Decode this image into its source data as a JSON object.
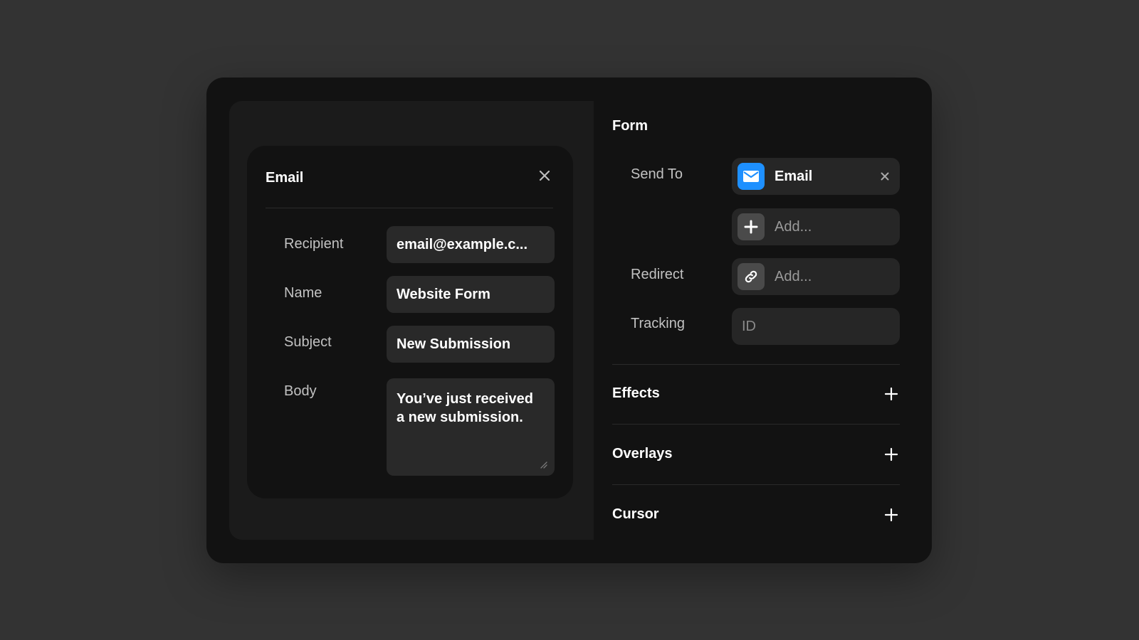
{
  "email_card": {
    "title": "Email",
    "fields": [
      {
        "label": "Recipient",
        "value": "email@example.c..."
      },
      {
        "label": "Name",
        "value": "Website Form"
      },
      {
        "label": "Subject",
        "value": "New Submission"
      },
      {
        "label": "Body",
        "value": "You’ve just received a new submission."
      }
    ]
  },
  "form_panel": {
    "title": "Form",
    "send_to": {
      "label": "Send To",
      "selected": "Email",
      "add_placeholder": "Add..."
    },
    "redirect": {
      "label": "Redirect",
      "placeholder": "Add..."
    },
    "tracking": {
      "label": "Tracking",
      "placeholder": "ID"
    },
    "sections": [
      {
        "label": "Effects"
      },
      {
        "label": "Overlays"
      },
      {
        "label": "Cursor"
      }
    ]
  },
  "icons": {
    "close": "close-icon",
    "mail": "mail-icon",
    "add": "plus-icon",
    "link": "link-icon",
    "resize": "resize-handle-icon"
  },
  "colors": {
    "page_background": "#333333",
    "panel_background": "#121212",
    "left_pane_background": "#1b1b1b",
    "input_background": "#292929",
    "email_accent": "#1e90ff"
  }
}
